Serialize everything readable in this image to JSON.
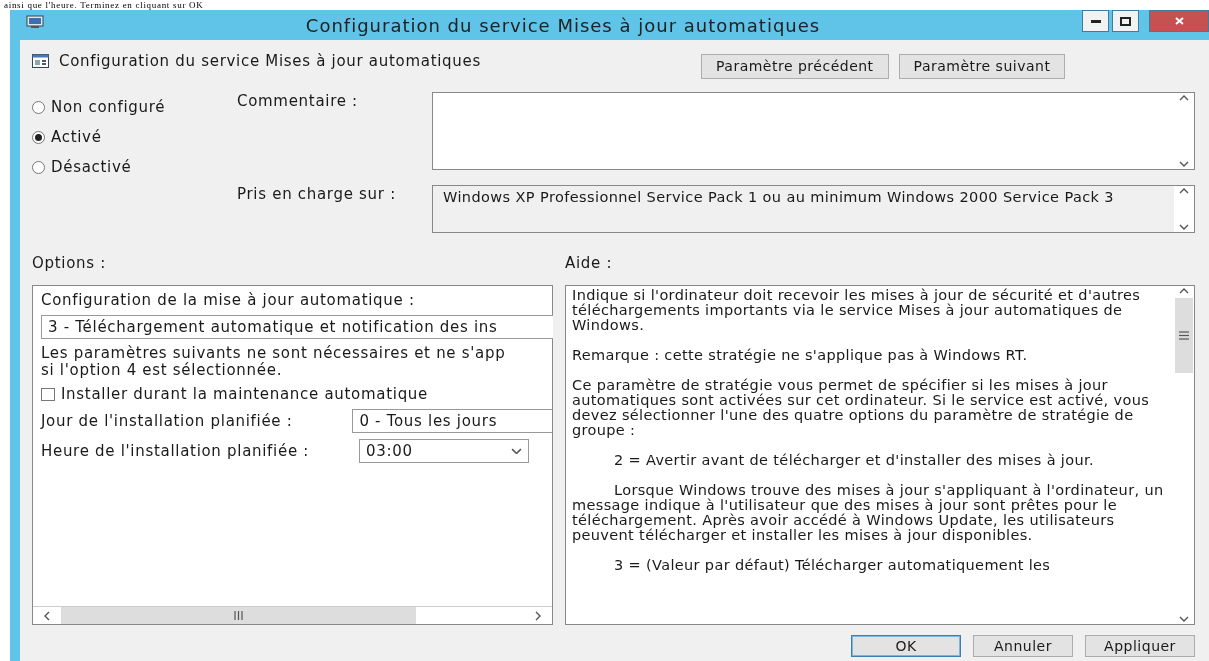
{
  "document_text": "ainsi que l'heure. Terminez en cliquant sur OK",
  "window": {
    "title": "Configuration du service Mises à jour automatiques"
  },
  "header": {
    "title": "Configuration du service Mises à jour automatiques",
    "buttons": [
      {
        "label": "Paramètre précédent"
      },
      {
        "label": "Paramètre suivant"
      }
    ]
  },
  "state_options": [
    {
      "label": "Non configuré",
      "selected": false
    },
    {
      "label": "Activé",
      "selected": true
    },
    {
      "label": "Désactivé",
      "selected": false
    }
  ],
  "comment": {
    "label": "Commentaire :"
  },
  "supported_on": {
    "label": "Pris en charge sur :",
    "value": "Windows XP Professionnel Service Pack 1 ou au minimum Windows 2000 Service Pack 3"
  },
  "options": {
    "label": "Options :",
    "heading": "Configuration de la mise à jour automatique :",
    "mode": "3 - Téléchargement automatique et notification des ins",
    "note": "Les paramètres suivants ne sont nécessaires et ne s'app\nsi l'option 4 est sélectionnée.",
    "checkbox": {
      "label": "Installer durant la maintenance automatique",
      "checked": false
    },
    "fields": [
      {
        "label": "Jour de l'installation planifiée :",
        "value": "0 - Tous les jours",
        "kind": "field"
      },
      {
        "label": "Heure de l'installation planifiée :",
        "value": "03:00",
        "kind": "dropdown"
      }
    ]
  },
  "help": {
    "label": "Aide :",
    "paragraphs": [
      {
        "text": "Indique si l'ordinateur doit recevoir les mises à jour de sécurité et d'autres téléchargements importants via le service Mises à jour automatiques de Windows.",
        "indented": false
      },
      {
        "text": "Remarque : cette stratégie ne s'applique pas à Windows RT.",
        "indented": false
      },
      {
        "text": "Ce paramètre de stratégie vous permet de spécifier si les mises à jour automatiques sont activées sur cet ordinateur. Si le service est activé, vous devez sélectionner l'une des quatre options du paramètre de stratégie de groupe :",
        "indented": false
      },
      {
        "text": "2 = Avertir avant de télécharger et d'installer des mises à jour.",
        "indented": true
      },
      {
        "text": "Lorsque Windows trouve des mises à jour s'appliquant à l'ordinateur, un message indique à l'utilisateur que des mises à jour sont prêtes pour le téléchargement. Après avoir accédé à Windows Update, les utilisateurs peuvent télécharger et installer les mises à jour disponibles.",
        "indented": true
      },
      {
        "text": "3 = (Valeur par défaut) Télécharger automatiquement les",
        "indented": true
      }
    ]
  },
  "buttons": [
    {
      "label": "OK",
      "default": true
    },
    {
      "label": "Annuler",
      "default": false
    },
    {
      "label": "Appliquer",
      "default": false
    }
  ]
}
